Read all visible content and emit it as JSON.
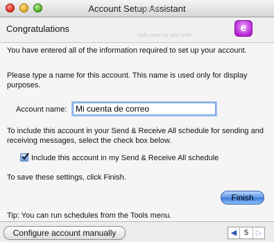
{
  "window": {
    "title": "Account Setup Assistant",
    "watermark": "solo10",
    "watermark_sub": "todo para su sitio web"
  },
  "header": {
    "title": "Congratulations",
    "logo_glyph": "e"
  },
  "main": {
    "intro": "You have entered all of the information required to set up your account.",
    "name_prompt": "Please type a name for this account. This name is used only for display purposes.",
    "account_name_label": "Account name:",
    "account_name_value": "Mi cuenta de correo",
    "schedule_prompt": "To include this account in your Send & Receive All schedule for sending and receiving messages, select the check box below.",
    "include_checkbox_label": "Include this account in my Send & Receive All schedule",
    "include_checked": true,
    "save_prompt": "To save these settings, click Finish.",
    "finish_label": "Finish",
    "tip": "Tip: You can run schedules from the Tools menu."
  },
  "footer": {
    "configure_label": "Configure account manually",
    "page_number": "5",
    "prev_glyph": "◀",
    "next_glyph": "▷"
  },
  "colors": {
    "accent_blue": "#3b78d3",
    "entourage_purple": "#b01fd0"
  }
}
